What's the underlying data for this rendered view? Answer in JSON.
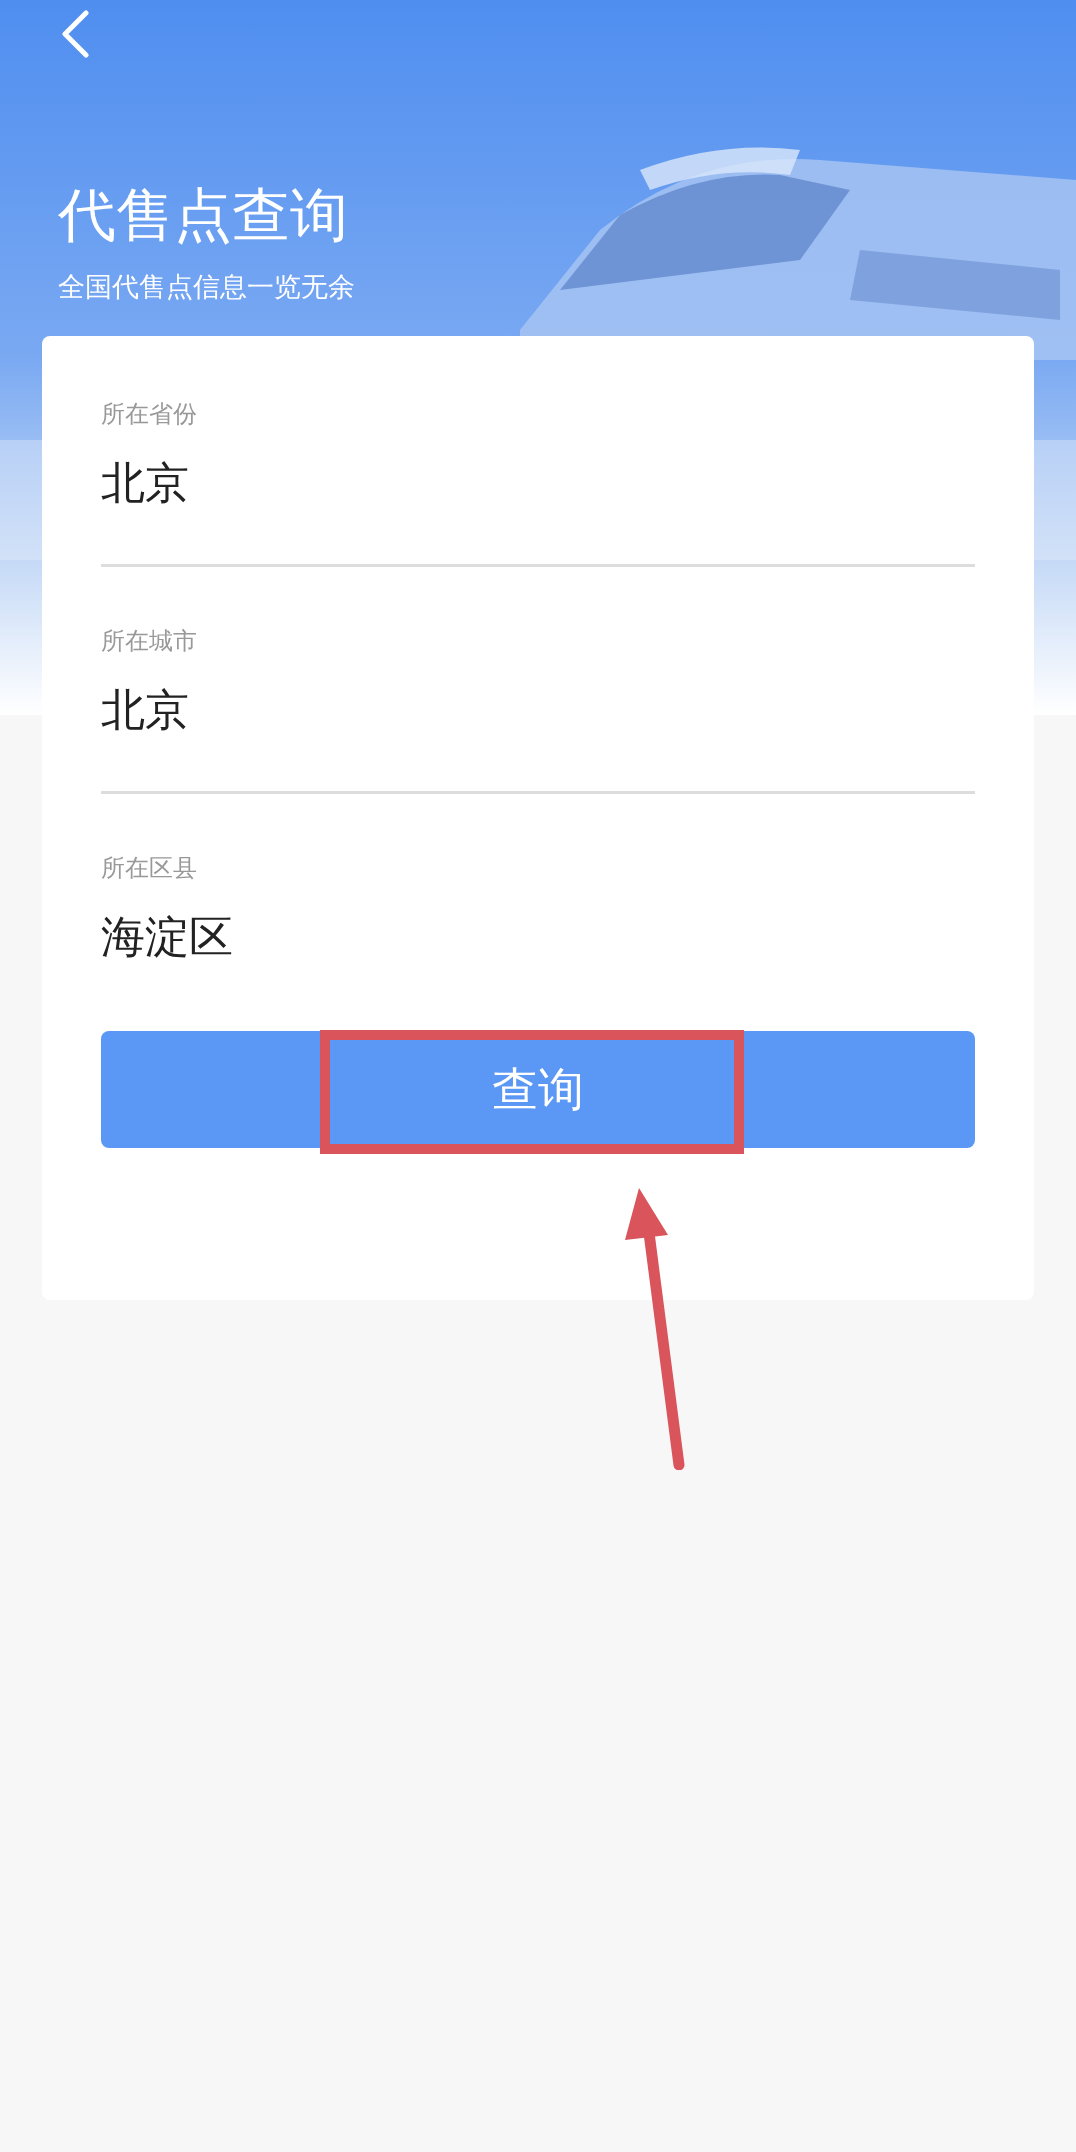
{
  "header": {
    "title": "代售点查询",
    "subtitle": "全国代售点信息一览无余"
  },
  "form": {
    "fields": [
      {
        "label": "所在省份",
        "value": "北京"
      },
      {
        "label": "所在城市",
        "value": "北京"
      },
      {
        "label": "所在区县",
        "value": "海淀区"
      }
    ]
  },
  "query_button": "查询"
}
